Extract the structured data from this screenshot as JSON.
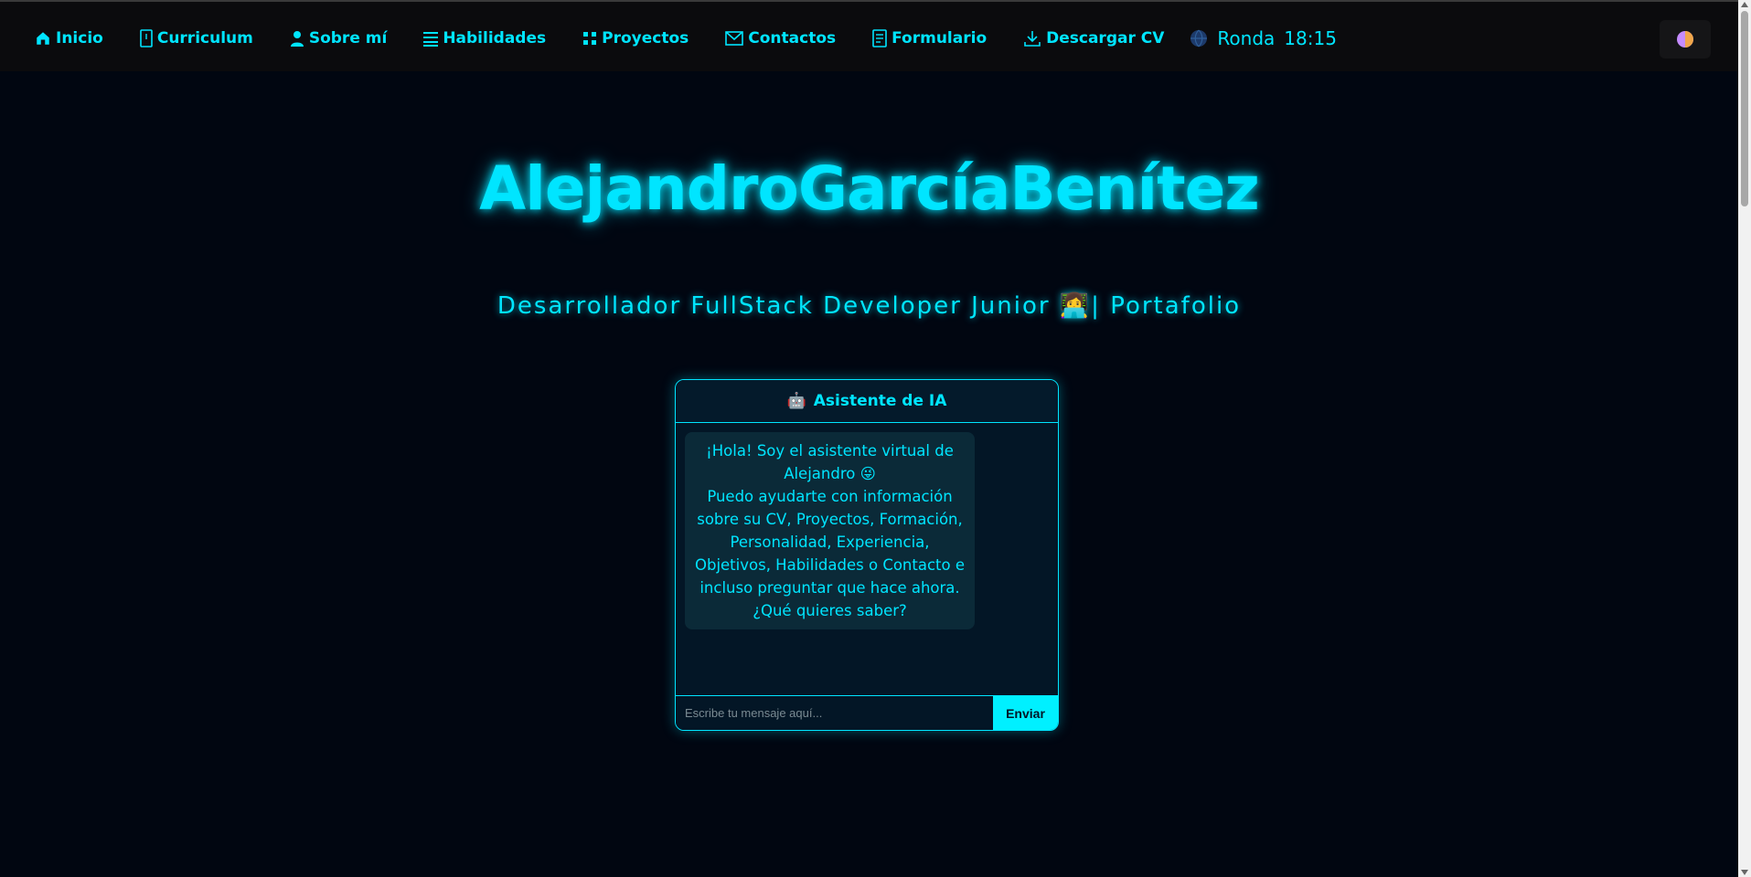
{
  "nav": {
    "items": [
      {
        "label": "Inicio",
        "icon": "home-icon"
      },
      {
        "label": "Curriculum",
        "icon": "document-icon"
      },
      {
        "label": "Sobre mí",
        "icon": "user-icon"
      },
      {
        "label": "Habilidades",
        "icon": "list-icon"
      },
      {
        "label": "Proyectos",
        "icon": "grid-icon"
      },
      {
        "label": "Contactos",
        "icon": "envelope-icon"
      },
      {
        "label": "Formulario",
        "icon": "form-icon"
      },
      {
        "label": "Descargar CV",
        "icon": "download-icon"
      }
    ],
    "clock": {
      "city": "Ronda",
      "time": "18:15",
      "icon": "globe-icon"
    },
    "theme_toggle_icon": "theme-toggle-icon"
  },
  "hero": {
    "name": "AlejandroGarcíaBenítez",
    "subtitle": "Desarrollador FullStack Developer Junior 👩‍💻| Portafolio"
  },
  "chat": {
    "title": "Asistente de IA",
    "title_icon": "🤖",
    "message_line1": "¡Hola! Soy el asistente virtual de Alejandro 😜",
    "message_line2": "Puedo ayudarte con información sobre su CV, Proyectos, Formación, Personalidad, Experiencia, Objetivos, Habilidades o Contacto e incluso preguntar que hace ahora. ¿Qué quieres saber?",
    "input_placeholder": "Escribe tu mensaje aquí...",
    "send_label": "Enviar"
  },
  "colors": {
    "accent": "#00e5ff",
    "background": "#010611",
    "topbar": "#0b0b0d"
  }
}
